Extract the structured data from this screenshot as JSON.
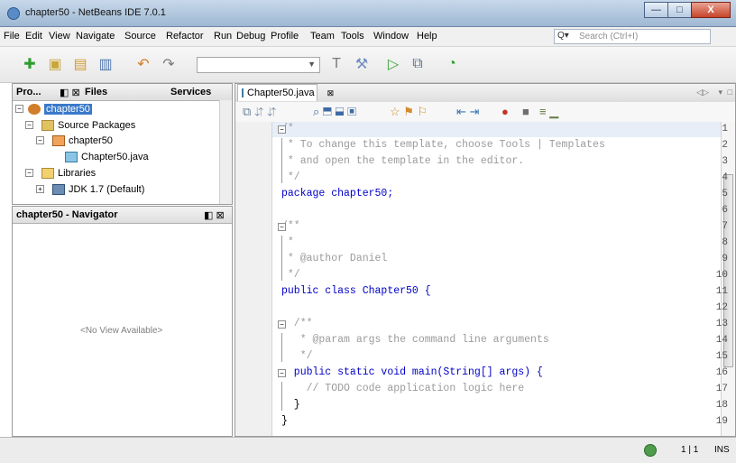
{
  "window": {
    "title": "chapter50 - NetBeans IDE 7.0.1",
    "buttons": [
      "—",
      "□",
      "X"
    ]
  },
  "menubar": {
    "items": [
      "File",
      "Edit",
      "View",
      "Navigate",
      "Source",
      "Refactor",
      "Run",
      "Debug",
      "Profile",
      "Team",
      "Tools",
      "Window",
      "Help"
    ],
    "search": {
      "placeholder": "Search (Ctrl+I)"
    }
  },
  "left_panels": {
    "top_tabs": [
      {
        "label": "Pro..."
      },
      {
        "label": "Files"
      },
      {
        "label": "Services"
      }
    ],
    "tree": [
      {
        "label": "chapter50",
        "selected": true
      },
      {
        "label": "Source Packages"
      },
      {
        "label": "chapter50"
      },
      {
        "label": "Chapter50.java"
      },
      {
        "label": "Libraries"
      },
      {
        "label": "JDK 1.7 (Default)"
      }
    ],
    "navigator": {
      "title": "chapter50 - Navigator",
      "empty_text": "<No View Available>"
    }
  },
  "editor": {
    "tab_label": "Chapter50.java",
    "lines": [
      {
        "n": "1",
        "text": "/*"
      },
      {
        "n": "2",
        "text": " * To change this template, choose Tools | Templates"
      },
      {
        "n": "3",
        "text": " * and open the template in the editor."
      },
      {
        "n": "4",
        "text": " */"
      },
      {
        "n": "5",
        "text": "package chapter50;"
      },
      {
        "n": "6",
        "text": ""
      },
      {
        "n": "7",
        "text": "/**"
      },
      {
        "n": "8",
        "text": " *"
      },
      {
        "n": "9",
        "text": " * @author Daniel"
      },
      {
        "n": "10",
        "text": " */"
      },
      {
        "n": "11",
        "text": "public class Chapter50 {"
      },
      {
        "n": "12",
        "text": ""
      },
      {
        "n": "13",
        "text": "  /**"
      },
      {
        "n": "14",
        "text": "   * @param args the command line arguments"
      },
      {
        "n": "15",
        "text": "   */"
      },
      {
        "n": "16",
        "text": "  public static void main(String[] args) {"
      },
      {
        "n": "17",
        "text": "    // TODO code application logic here"
      },
      {
        "n": "18",
        "text": "  }"
      },
      {
        "n": "19",
        "text": "}"
      }
    ]
  },
  "statusbar": {
    "position": "1 | 1",
    "mode": "INS"
  }
}
